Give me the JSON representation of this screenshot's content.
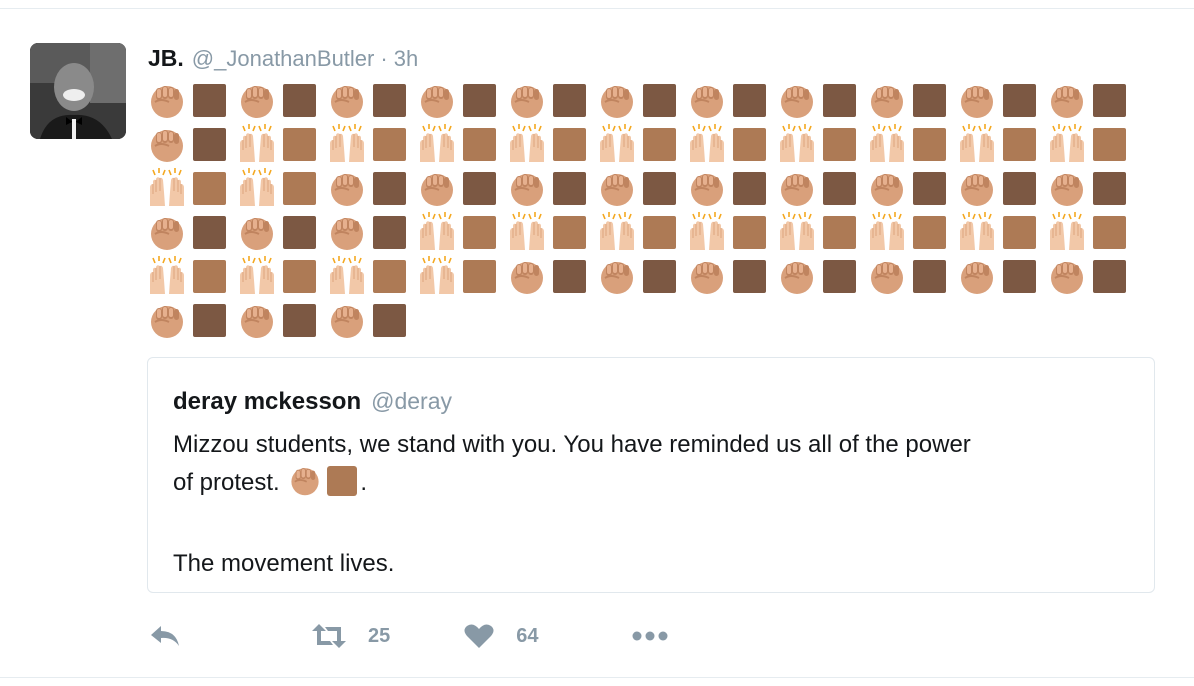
{
  "tweet": {
    "author": {
      "fullname": "JB.",
      "username": "@_JonathanButler",
      "separator": "·",
      "timestamp": "3h"
    },
    "emoji_rows": [
      [
        "fist-medium",
        "square-dark",
        "fist-medium",
        "square-dark",
        "fist-medium",
        "square-dark",
        "fist-medium",
        "square-dark",
        "fist-medium",
        "square-dark",
        "fist-medium",
        "square-dark",
        "fist-medium",
        "square-dark",
        "fist-medium",
        "square-dark",
        "fist-medium",
        "square-dark",
        "fist-medium",
        "square-dark",
        "fist-medium",
        "square-dark"
      ],
      [
        "fist-medium",
        "square-dark",
        "raised-hands",
        "square-medium",
        "raised-hands",
        "square-medium",
        "raised-hands",
        "square-medium",
        "raised-hands",
        "square-medium",
        "raised-hands",
        "square-medium",
        "raised-hands",
        "square-medium",
        "raised-hands",
        "square-medium",
        "raised-hands",
        "square-medium",
        "raised-hands",
        "square-medium",
        "raised-hands",
        "square-medium"
      ],
      [
        "raised-hands",
        "square-medium",
        "raised-hands",
        "square-medium",
        "fist-medium",
        "square-dark",
        "fist-medium",
        "square-dark",
        "fist-medium",
        "square-dark",
        "fist-medium",
        "square-dark",
        "fist-medium",
        "square-dark",
        "fist-medium",
        "square-dark",
        "fist-medium",
        "square-dark",
        "fist-medium",
        "square-dark",
        "fist-medium",
        "square-dark"
      ],
      [
        "fist-medium",
        "square-dark",
        "fist-medium",
        "square-dark",
        "fist-medium",
        "square-dark",
        "raised-hands",
        "square-medium",
        "raised-hands",
        "square-medium",
        "raised-hands",
        "square-medium",
        "raised-hands",
        "square-medium",
        "raised-hands",
        "square-medium",
        "raised-hands",
        "square-medium",
        "raised-hands",
        "square-medium",
        "raised-hands",
        "square-medium"
      ],
      [
        "raised-hands",
        "square-medium",
        "raised-hands",
        "square-medium",
        "raised-hands",
        "square-medium",
        "raised-hands",
        "square-medium",
        "fist-medium",
        "square-dark",
        "fist-medium",
        "square-dark",
        "fist-medium",
        "square-dark",
        "fist-medium",
        "square-dark",
        "fist-medium",
        "square-dark",
        "fist-medium",
        "square-dark",
        "fist-medium",
        "square-dark"
      ],
      [
        "fist-medium",
        "square-dark",
        "fist-medium",
        "square-dark",
        "fist-medium",
        "square-dark"
      ]
    ],
    "quoted": {
      "name": "deray mckesson",
      "username": "@deray",
      "text_line1": "Mizzou students, we stand with you. You have reminded us all of the power",
      "text_line2_prefix": "of protest.",
      "text_line2_suffix": ".",
      "text_line3": "The movement lives."
    },
    "actions": {
      "reply_icon": "reply-icon",
      "retweet_icon": "retweet-icon",
      "retweet_count": "25",
      "like_icon": "heart-icon",
      "like_count": "64",
      "more_icon": "more-dots-icon"
    }
  },
  "colors": {
    "fist_skin": "#d9a07b",
    "fist_shadow": "#c0845f",
    "square_dark": "#7c5843",
    "square_medium": "#ad7a55",
    "hands_skin": "#f2c8a8",
    "hands_shadow": "#e0aa85",
    "sparkle": "#f4a820",
    "muted": "#8899a6",
    "border": "#e1e8ed"
  }
}
